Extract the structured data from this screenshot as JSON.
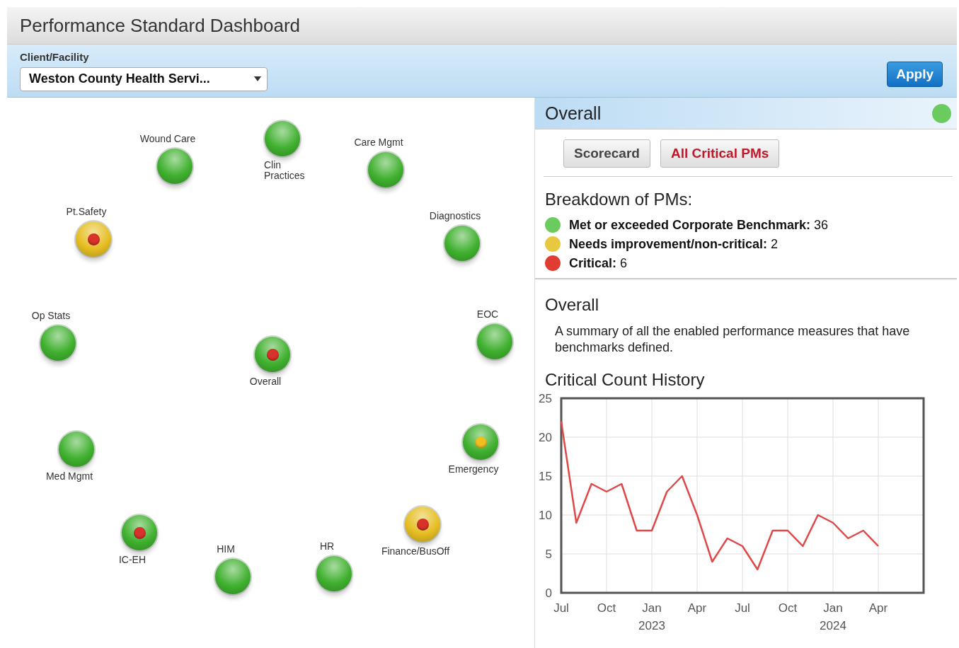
{
  "window": {
    "title": "Performance Standard Dashboard"
  },
  "filter": {
    "label": "Client/Facility",
    "value": "Weston County Health Servi...",
    "apply": "Apply"
  },
  "nodes": [
    {
      "label": "Wound Care",
      "color": "#3fb02e"
    },
    {
      "label": "Clin Practices",
      "color": "#3fb02e"
    },
    {
      "label": "Care Mgmt",
      "color": "#3fb02e"
    },
    {
      "label": "Pt.Safety",
      "color": "#e6be22",
      "alert": {
        "color": "#d8322a"
      }
    },
    {
      "label": "Diagnostics",
      "color": "#3fb02e"
    },
    {
      "label": "Op Stats",
      "color": "#3fb02e"
    },
    {
      "label": "Overall",
      "color": "#3fb02e",
      "alert": {
        "color": "#d8322a"
      }
    },
    {
      "label": "EOC",
      "color": "#3fb02e"
    },
    {
      "label": "Med Mgmt",
      "color": "#3fb02e"
    },
    {
      "label": "Emergency",
      "color": "#3fb02e",
      "alert": {
        "color": "#f0c020"
      }
    },
    {
      "label": "IC-EH",
      "color": "#3fb02e",
      "alert": {
        "color": "#d8322a"
      }
    },
    {
      "label": "HIM",
      "color": "#3fb02e"
    },
    {
      "label": "HR",
      "color": "#3fb02e"
    },
    {
      "label": "Finance/BusOff",
      "color": "#e6be22",
      "alert": {
        "color": "#d8322a"
      }
    }
  ],
  "panel": {
    "title": "Overall",
    "status": {
      "color": "#6ccb5f"
    },
    "buttons": [
      {
        "label": "Scorecard",
        "kind": "plain"
      },
      {
        "label": "All Critical PMs",
        "kind": "critical"
      }
    ],
    "breakdown_title": "Breakdown of PMs:",
    "breakdown": [
      {
        "label": "Met or exceeded Corporate Benchmark:",
        "value": "36",
        "color": "#6ccb5f"
      },
      {
        "label": "Needs improvement/non-critical:",
        "value": "2",
        "color": "#e8c840"
      },
      {
        "label": "Critical:",
        "value": "6",
        "color": "#e03c31"
      }
    ],
    "section_title": "Overall",
    "description": "A summary of all the enabled performance measures that have benchmarks defined.",
    "chart_title": "Critical Count History",
    "chart_data": {
      "type": "line",
      "x": [
        "2022-07",
        "2022-08",
        "2022-09",
        "2022-10",
        "2022-11",
        "2022-12",
        "2023-01",
        "2023-02",
        "2023-03",
        "2023-04",
        "2023-05",
        "2023-06",
        "2023-07",
        "2023-08",
        "2023-09",
        "2023-10",
        "2023-11",
        "2023-12",
        "2024-01",
        "2024-02",
        "2024-03",
        "2024-04"
      ],
      "series": [
        {
          "color": "#e04848",
          "values": [
            22,
            9,
            14,
            13,
            14,
            8,
            8,
            13,
            15,
            10,
            4,
            7,
            6,
            3,
            8,
            8,
            6,
            10,
            9,
            7,
            8,
            6
          ]
        }
      ],
      "xlim": [
        "2022-07",
        "2024-07"
      ],
      "ylim": [
        0,
        25
      ],
      "yticks": [
        0,
        5,
        10,
        15,
        20,
        25
      ],
      "grid": true,
      "xticks": [
        {
          "value": "2022-07",
          "label": "Jul"
        },
        {
          "value": "2022-10",
          "label": "Oct"
        },
        {
          "value": "2023-01",
          "label": "Jan\n2023"
        },
        {
          "value": "2023-04",
          "label": "Apr"
        },
        {
          "value": "2023-07",
          "label": "Jul"
        },
        {
          "value": "2023-10",
          "label": "Oct"
        },
        {
          "value": "2024-01",
          "label": "Jan\n2024"
        },
        {
          "value": "2024-04",
          "label": "Apr"
        }
      ]
    }
  }
}
